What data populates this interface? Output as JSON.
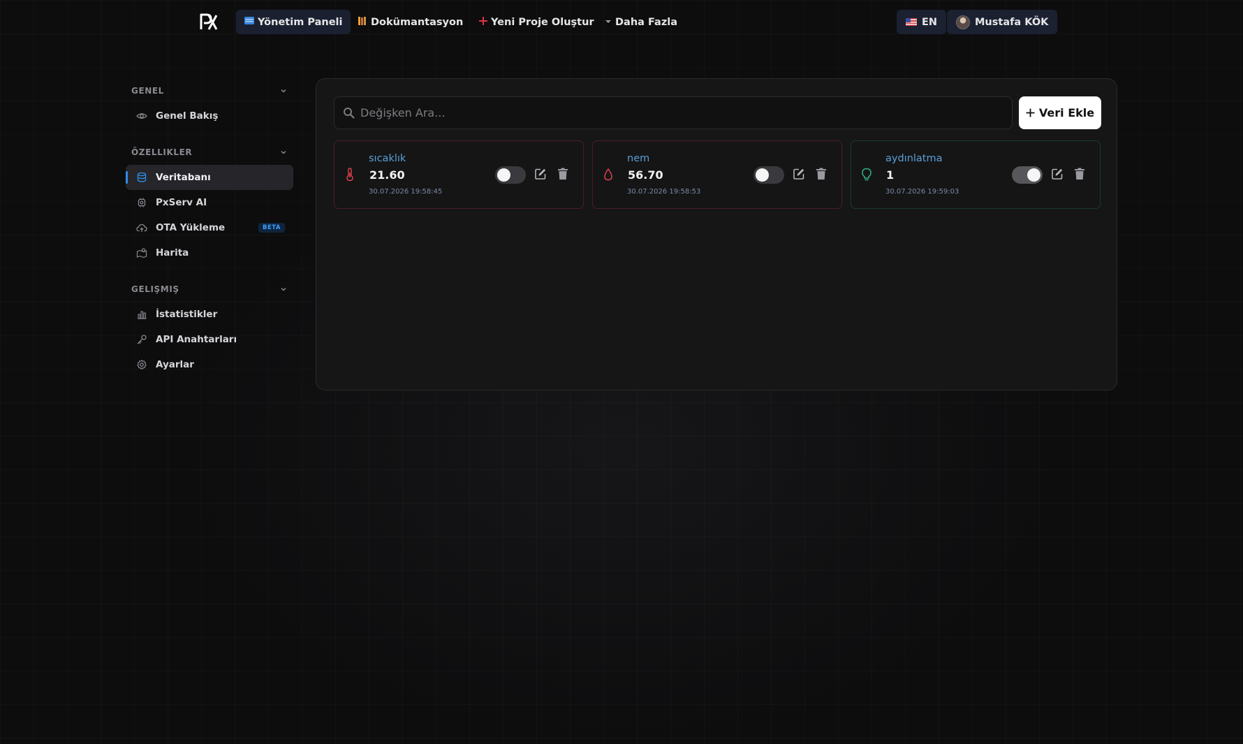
{
  "topbar": {
    "logo_text": "PX",
    "nav": [
      {
        "label": "Yönetim Paneli",
        "icon": "dashboard-icon"
      },
      {
        "label": "Dokümantasyon",
        "icon": "books-icon"
      },
      {
        "label": "Yeni Proje Oluştur",
        "icon": "plus-icon"
      },
      {
        "label": "Daha Fazla",
        "icon": "caret-down-icon"
      }
    ],
    "language": {
      "label": "EN",
      "icon": "us-flag-icon"
    },
    "user": {
      "name": "Mustafa KÖK",
      "icon": "avatar"
    }
  },
  "sidebar": {
    "sections": [
      {
        "title": "GENEL",
        "items": [
          {
            "label": "Genel Bakış",
            "icon": "eye-icon"
          }
        ]
      },
      {
        "title": "ÖZELLIKLER",
        "items": [
          {
            "label": "Veritabanı",
            "icon": "database-icon",
            "active": true
          },
          {
            "label": "PxServ AI",
            "icon": "ai-chip-icon"
          },
          {
            "label": "OTA Yükleme",
            "icon": "cloud-upload-icon",
            "badge": "BETA"
          },
          {
            "label": "Harita",
            "icon": "map-icon"
          }
        ]
      },
      {
        "title": "GELIŞMIŞ",
        "items": [
          {
            "label": "İstatistikler",
            "icon": "bar-chart-icon"
          },
          {
            "label": "API Anahtarları",
            "icon": "key-icon"
          },
          {
            "label": "Ayarlar",
            "icon": "gear-icon"
          }
        ]
      }
    ]
  },
  "main": {
    "search": {
      "placeholder": "Değişken Ara..."
    },
    "add_button": {
      "label": "Veri Ekle",
      "icon": "plus-icon"
    },
    "variables": [
      {
        "name": "sıcaklık",
        "value": "21.60",
        "timestamp": "30.07.2026 19:58:45",
        "icon": "thermometer-icon",
        "accent": "#e0434f",
        "enabled": false
      },
      {
        "name": "nem",
        "value": "56.70",
        "timestamp": "30.07.2026 19:58:53",
        "icon": "droplet-icon",
        "accent": "#e0434f",
        "enabled": false
      },
      {
        "name": "aydınlatma",
        "value": "1",
        "timestamp": "30.07.2026 19:59:03",
        "icon": "lightbulb-icon",
        "accent": "#2fb382",
        "enabled": true
      }
    ]
  },
  "colors": {
    "background": "#0d0d0e",
    "accent_blue": "#2f8de4",
    "card_name": "#5b9fd4"
  }
}
